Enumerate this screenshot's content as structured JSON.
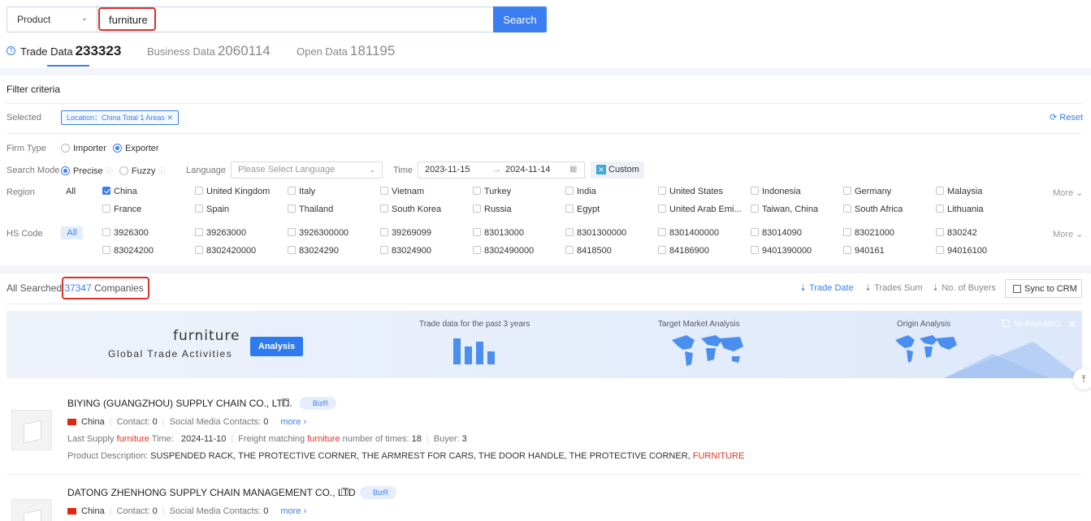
{
  "search": {
    "type_label": "Product",
    "query": "furniture",
    "button_label": "Search"
  },
  "tabs": [
    {
      "label": "Trade Data",
      "count": "233323"
    },
    {
      "label": "Business Data",
      "count": "2060114"
    },
    {
      "label": "Open Data",
      "count": "181195"
    }
  ],
  "filter": {
    "title": "Filter criteria",
    "selected_label": "Selected",
    "selected_tag": "Location：China Total 1 Areas",
    "reset_label": "Reset",
    "firm_type_label": "Firm Type",
    "firm_types": [
      "Importer",
      "Exporter"
    ],
    "search_mode_label": "Search Mode",
    "search_modes": [
      "Precise",
      "Fuzzy"
    ],
    "language_label": "Language",
    "language_placeholder": "Please Select Language",
    "time_label": "Time",
    "date_from": "2023-11-15",
    "date_arrow": "→",
    "date_to": "2024-11-14",
    "custom_label": "Custom",
    "region_label": "Region",
    "all_label": "All",
    "more_label": "More",
    "regions_row1": [
      "China",
      "United Kingdom",
      "Italy",
      "Vietnam",
      "Turkey",
      "India",
      "United States",
      "Indonesia",
      "Germany",
      "Malaysia"
    ],
    "regions_row2": [
      "France",
      "Spain",
      "Thailand",
      "South Korea",
      "Russia",
      "Egypt",
      "United Arab Emi...",
      "Taiwan, China",
      "South Africa",
      "Lithuania"
    ],
    "hs_label": "HS Code",
    "hs_row1": [
      "3926300",
      "39263000",
      "3926300000",
      "39269099",
      "83013000",
      "8301300000",
      "8301400000",
      "83014090",
      "83021000",
      "830242"
    ],
    "hs_row2": [
      "83024200",
      "8302420000",
      "83024290",
      "83024900",
      "8302490000",
      "8418500",
      "84186900",
      "9401390000",
      "940161",
      "94016100"
    ]
  },
  "results": {
    "prefix": "All Searched",
    "count": "37347",
    "suffix": "Companies",
    "sort_options": [
      "Trade Date",
      "Trades Sum",
      "No. of Buyers"
    ],
    "sync_label": "Sync to CRM"
  },
  "banner": {
    "keyword": "furniture",
    "subtitle": "Global Trade Activities",
    "analysis_label": "Analysis",
    "captions": [
      "Trade data for the past 3 years",
      "Target Market Analysis",
      "Origin Analysis"
    ],
    "no_push_label": "No Push MSG",
    "close_label": "✕"
  },
  "companies": [
    {
      "name": "BIYING (GUANGZHOU) SUPPLY CHAIN CO., LTD.",
      "badge": "BizR",
      "country": "China",
      "contact_label": "Contact:",
      "contact": "0",
      "social_label": "Social Media Contacts:",
      "social": "0",
      "more": "more",
      "last_supply_pre": "Last Supply",
      "keyword": "furniture",
      "last_supply_post": "Time:",
      "last_supply_date": "2024-11-10",
      "freight_pre": "Freight matching",
      "freight_post": "number of times:",
      "freight_count": "18",
      "buyer_label": "Buyer:",
      "buyer": "3",
      "desc_label": "Product Description:",
      "desc": "SUSPENDED RACK, THE PROTECTIVE CORNER, THE ARMREST FOR CARS, THE DOOR HANDLE, THE PROTECTIVE CORNER,",
      "desc_highlight": "FURNITURE"
    },
    {
      "name": "DATONG ZHENHONG SUPPLY CHAIN MANAGEMENT CO., LTD",
      "badge": "BizR",
      "country": "China",
      "contact_label": "Contact:",
      "contact": "0",
      "social_label": "Social Media Contacts:",
      "social": "0",
      "more": "more"
    }
  ],
  "colors": {
    "accent": "#3b7ef0",
    "highlight_red": "#d9302c"
  }
}
